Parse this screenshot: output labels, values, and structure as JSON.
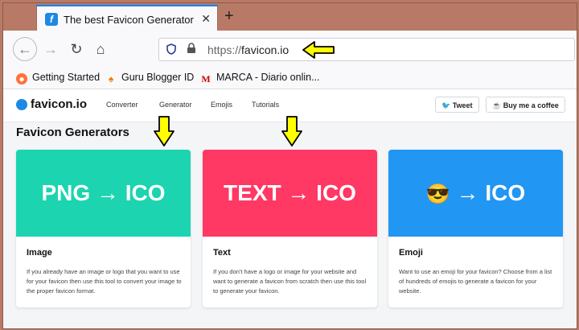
{
  "browser": {
    "tab_title": "The best Favicon Generator (co",
    "tab_favicon_letter": "f",
    "tab_close": "✕",
    "new_tab": "+",
    "url_scheme": "https://",
    "url_host": "favicon.io"
  },
  "bookmarks": [
    {
      "label": "Getting Started"
    },
    {
      "label": "Guru Blogger ID"
    },
    {
      "label": "MARCA - Diario onlin..."
    }
  ],
  "site": {
    "logo": "favicon.io",
    "nav": [
      "Converter",
      "Generator",
      "Emojis",
      "Tutorials"
    ],
    "tweet": "Tweet",
    "coffee": "Buy me a coffee",
    "section_title": "Favicon Generators"
  },
  "cards": [
    {
      "banner": "PNG → ICO",
      "title": "Image",
      "desc": "If you already have an image or logo that you want to use for your favicon then use this tool to convert your image to the proper favicon format.",
      "color": "#1cd4b0"
    },
    {
      "banner": "TEXT → ICO",
      "title": "Text",
      "desc": "If you don't have a logo or image for your website and want to generate a favicon from scratch then use this tool to generate your favicon.",
      "color": "#ff3864"
    },
    {
      "banner_emoji": "😎",
      "banner": "→ ICO",
      "title": "Emoji",
      "desc": "Want to use an emoji for your favicon? Choose from a list of hundreds of emojis to generate a favicon for your website.",
      "color": "#2196f3"
    }
  ],
  "colors": {
    "accent": "#1e88e5",
    "arrow": "#ffff00"
  }
}
